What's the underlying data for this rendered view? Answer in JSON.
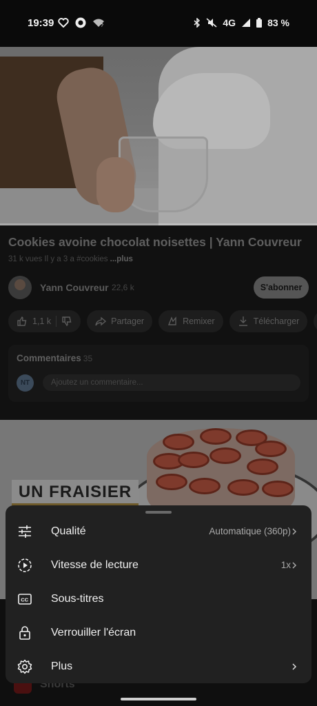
{
  "status_bar": {
    "time": "19:39",
    "network": "4G",
    "battery": "83 %",
    "icons": [
      "heart-icon",
      "app-icon",
      "wifi-question-icon",
      "bluetooth-icon",
      "mute-icon",
      "signal-icon",
      "battery-icon"
    ]
  },
  "video": {
    "title": "Cookies avoine chocolat noisettes | Yann Couvreur",
    "meta": "31 k vues  Il y a 3 a  #cookies",
    "more": "...plus",
    "channel_name": "Yann Couvreur",
    "subscribers": "22,6 k",
    "subscribe_label": "S'abonner",
    "like_count": "1,1 k",
    "actions": {
      "share": "Partager",
      "remix": "Remixer",
      "download": "Télécharger"
    }
  },
  "comments": {
    "label": "Commentaires",
    "count": "35",
    "user_initials": "NT",
    "placeholder": "Ajoutez un commentaire..."
  },
  "next_video": {
    "banner": "UN FRAISIER"
  },
  "shorts": {
    "label": "Shorts"
  },
  "sheet": {
    "items": [
      {
        "label": "Qualité",
        "value": "Automatique (360p)",
        "icon": "tune-icon"
      },
      {
        "label": "Vitesse de lecture",
        "value": "1x",
        "icon": "playback-speed-icon"
      },
      {
        "label": "Sous-titres",
        "value": "",
        "icon": "captions-icon"
      },
      {
        "label": "Verrouiller l'écran",
        "value": "",
        "icon": "lock-icon"
      },
      {
        "label": "Plus",
        "value": "",
        "icon": "gear-icon"
      }
    ]
  },
  "colors": {
    "sheet_bg": "#212121",
    "page_bg": "#0f0f0f"
  }
}
